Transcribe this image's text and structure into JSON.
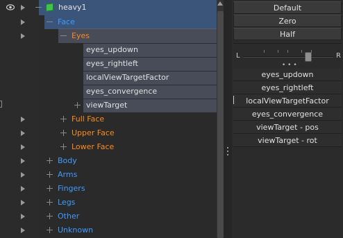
{
  "tree": {
    "root": {
      "label": "heavy1"
    },
    "nodes": [
      {
        "label": "Face",
        "color": "blue"
      },
      {
        "label": "Eyes",
        "color": "orange"
      },
      {
        "label": "eyes_updown",
        "color": "white"
      },
      {
        "label": "eyes_rightleft",
        "color": "white"
      },
      {
        "label": "localViewTargetFactor",
        "color": "white"
      },
      {
        "label": "eyes_convergence",
        "color": "white"
      },
      {
        "label": "viewTarget",
        "color": "white"
      },
      {
        "label": "Full Face",
        "color": "orange"
      },
      {
        "label": "Upper Face",
        "color": "orange"
      },
      {
        "label": "Lower Face",
        "color": "orange"
      },
      {
        "label": "Body",
        "color": "blue"
      },
      {
        "label": "Arms",
        "color": "blue"
      },
      {
        "label": "Fingers",
        "color": "blue"
      },
      {
        "label": "Legs",
        "color": "blue"
      },
      {
        "label": "Other",
        "color": "blue"
      },
      {
        "label": "Unknown",
        "color": "blue"
      }
    ]
  },
  "pose_buttons": {
    "default_label": "Default",
    "zero_label": "Zero",
    "half_label": "Half"
  },
  "slider": {
    "left_label": "L",
    "right_label": "R",
    "dots": "• • •",
    "value": 0.72
  },
  "pinned_controls": [
    "eyes_updown",
    "eyes_rightleft",
    "localViewTargetFactor",
    "eyes_convergence",
    "viewTarget - pos",
    "viewTarget - rot"
  ],
  "colors": {
    "blue_label": "#3f9bff",
    "orange_label": "#ff8a1a",
    "selection": "#3a5579",
    "cube": "#3fc24e"
  }
}
